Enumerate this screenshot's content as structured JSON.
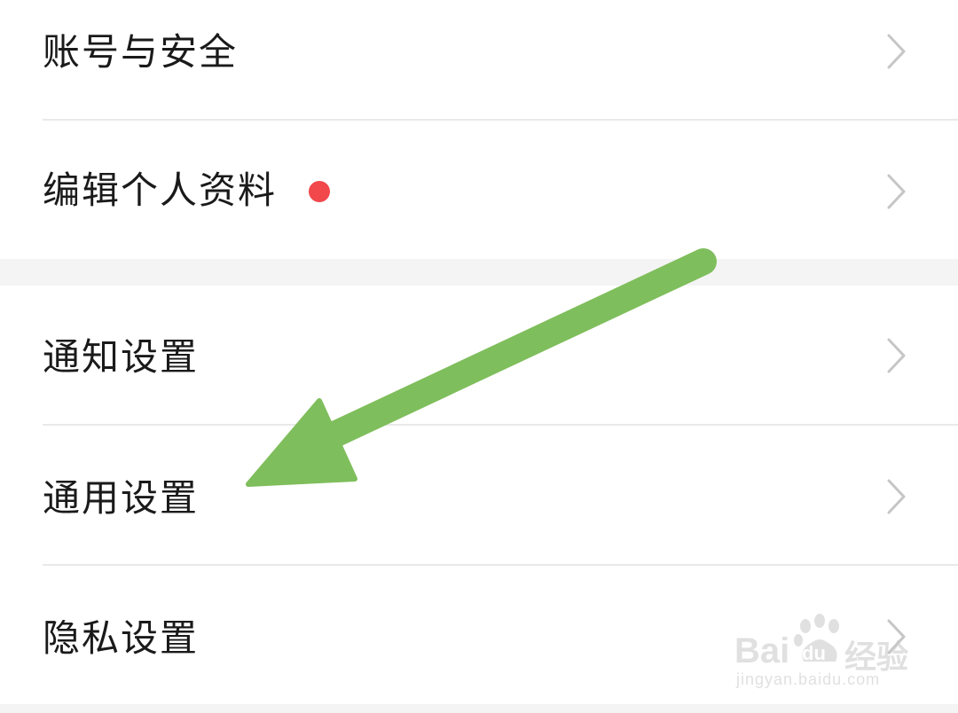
{
  "settings": {
    "group1": [
      {
        "label": "账号与安全",
        "has_badge": false
      },
      {
        "label": "编辑个人资料",
        "has_badge": true
      }
    ],
    "group2": [
      {
        "label": "通知设置"
      },
      {
        "label": "通用设置"
      },
      {
        "label": "隐私设置"
      }
    ]
  },
  "colors": {
    "badge": "#f2474b",
    "arrow": "#7fbe5c",
    "section_gap": "#f4f4f4",
    "divider": "#e9e9e9",
    "chevron": "#c6c6c6"
  },
  "annotation": {
    "arrow_points_to": "通用设置"
  },
  "watermark": {
    "brand_latin": "Bai",
    "brand_latin2": "du",
    "brand_cn": "经验",
    "url": "jingyan.baidu.com"
  }
}
